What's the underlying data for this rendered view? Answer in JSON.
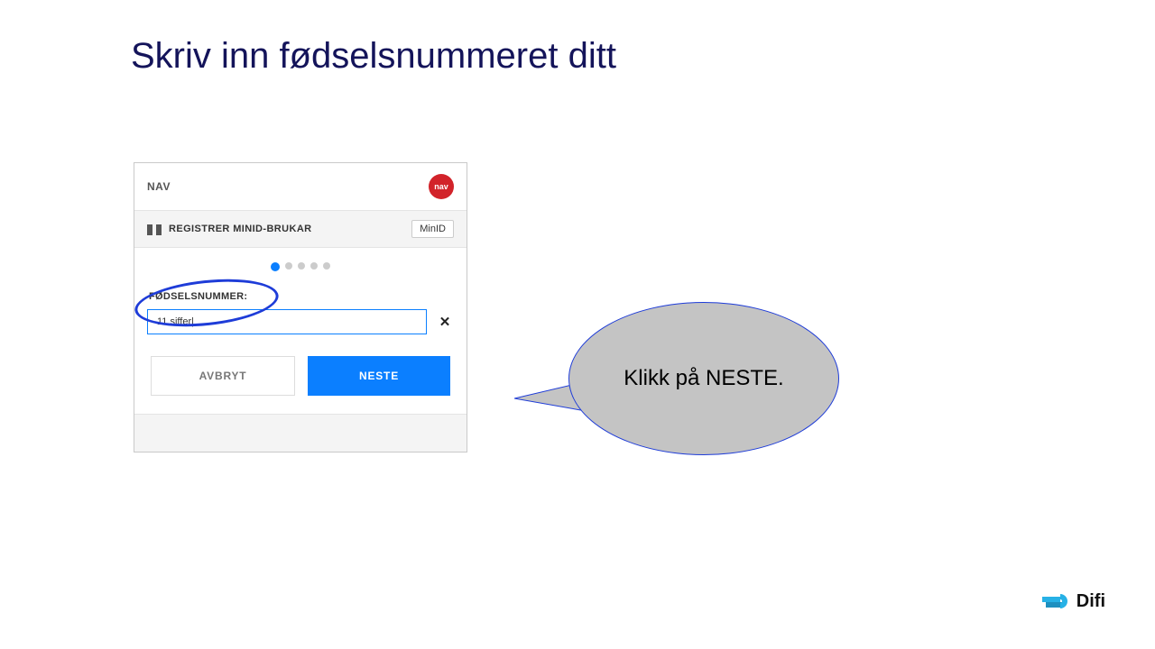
{
  "slide": {
    "title": "Skriv inn fødselsnummeret ditt"
  },
  "card": {
    "nav_label": "NAV",
    "nav_logo_text": "nav",
    "subheader_text": "REGISTRER MINID-BRUKAR",
    "minid_badge": "MinID",
    "field_label": "FØDSELSNUMMER:",
    "input_value": "11 siffer|",
    "clear_symbol": "✕",
    "cancel_label": "AVBRYT",
    "next_label": "NESTE",
    "progress": {
      "total": 5,
      "active_index": 0
    }
  },
  "callout": {
    "text": "Klikk på NESTE."
  },
  "footer": {
    "difi_label": "Difi"
  },
  "colors": {
    "title": "#14145a",
    "accent_blue": "#0b7fff",
    "highlight_blue": "#1e3cd8",
    "nav_red": "#d2232a",
    "callout_gray": "#c4c4c4"
  }
}
